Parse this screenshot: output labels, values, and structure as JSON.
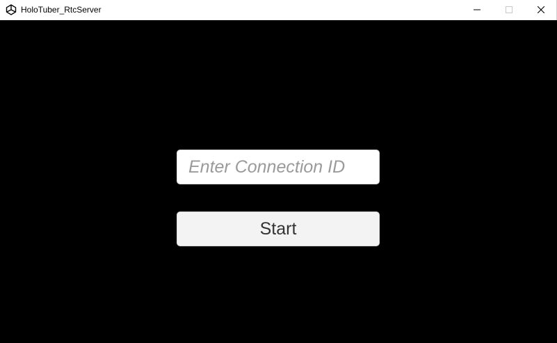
{
  "window": {
    "title": "HoloTuber_RtcServer",
    "app_icon": "unity-icon",
    "controls": {
      "minimize": "minimize-icon",
      "maximize": "maximize-icon",
      "close": "close-icon"
    }
  },
  "form": {
    "connection_id": {
      "value": "",
      "placeholder": "Enter Connection ID"
    },
    "start_label": "Start"
  },
  "colors": {
    "background": "#000000",
    "titlebar": "#ffffff",
    "input_bg": "#ffffff",
    "button_bg": "#f3f3f3",
    "placeholder": "#9a9a9a",
    "text": "#333333"
  }
}
